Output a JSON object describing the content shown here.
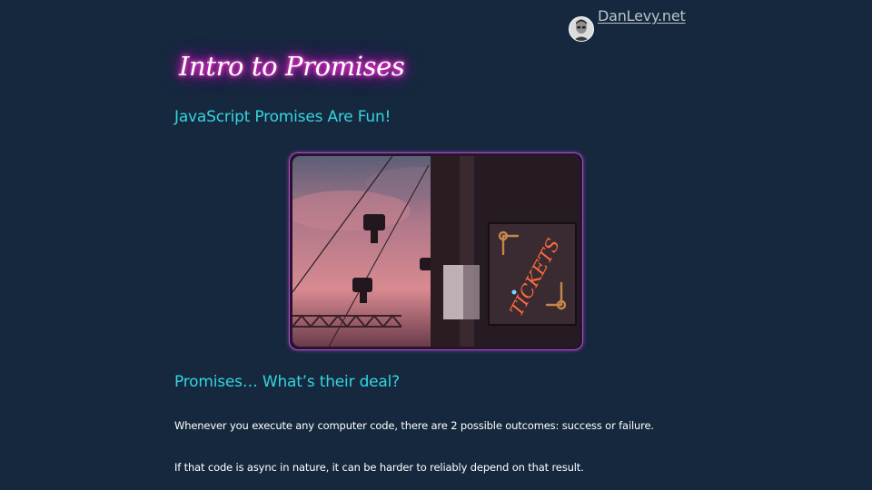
{
  "header": {
    "site_name": "DanLevy.net"
  },
  "article": {
    "title": "Intro to Promises",
    "subtitle": "JavaScript Promises Are Fun!",
    "hero_image": {
      "sign_text": "TICKETS",
      "icon": "ferris-wheel-photo"
    },
    "section_heading": "Promises… What’s their deal?",
    "paragraphs": [
      "Whenever you execute any computer code, there are 2 possible outcomes: success or failure.",
      "If that code is async in nature, it can be harder to reliably depend on that result."
    ]
  },
  "colors": {
    "background": "#15283d",
    "accent_cyan": "#35d4e0",
    "neon_pink": "#ff1fc9",
    "frame_purple": "#b24ac8",
    "sign_neon": "#ff5a2e"
  }
}
